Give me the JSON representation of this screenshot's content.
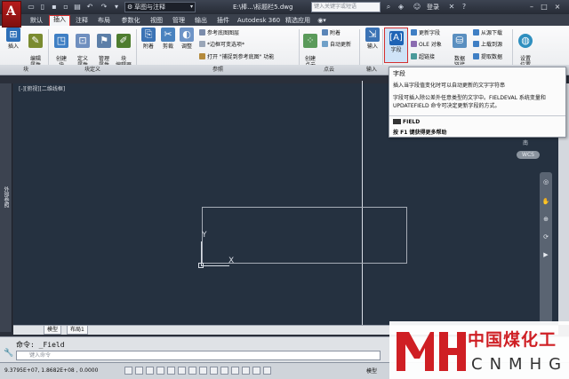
{
  "titlebar": {
    "workspace": "草图与注释",
    "doc_title": "E:\\棒...\\标题栏5.dwg",
    "search_placeholder": "键入关键字或短语",
    "login": "登录"
  },
  "tabs": [
    {
      "label": "默认"
    },
    {
      "label": "插入"
    },
    {
      "label": "注释"
    },
    {
      "label": "布局"
    },
    {
      "label": "参数化"
    },
    {
      "label": "视图"
    },
    {
      "label": "管理"
    },
    {
      "label": "输出"
    },
    {
      "label": "插件"
    },
    {
      "label": "Autodesk 360"
    },
    {
      "label": "精选应用"
    }
  ],
  "ribbon": {
    "insert": "插入",
    "edit_attr": "编辑\n属性",
    "create_block": "创建\n块",
    "define_attr": "定义\n属性",
    "manage_attr": "管理\n属性",
    "block_editor": "块\n编辑器",
    "attach": "附着",
    "clip": "剪裁",
    "adjust": "调整",
    "ref_layers": "参考底图图层",
    "frame_variable": "*边框可变选项*",
    "snap_ref": "打开 \"捕捉到参考底图\" 功能",
    "create_pointcloud": "创建\n点云",
    "attach2": "附着",
    "auto_update": "自动更新",
    "import": "输入",
    "field": "字段",
    "update_fields": "更新字段",
    "ole_object": "OLE 对象",
    "hyperlink": "超链接",
    "data_link": "数据\n链接",
    "download_from": "从源下载",
    "upload_to": "上载到源",
    "extract_data": "提取数据",
    "set_location": "设置\n位置"
  },
  "panels": {
    "block": "块",
    "block_def": "块定义",
    "reference": "参照",
    "pointcloud": "点云",
    "import": "输入"
  },
  "canvas": {
    "viewport_label": "[-][俯视][二维线框]",
    "ucs_y": "Y",
    "ucs_x": "X",
    "wcs": "WCS",
    "north": "南"
  },
  "left_palette": "外部参照",
  "layout_tabs": [
    "模型",
    "布局1"
  ],
  "command": {
    "history": "命令:  _Field",
    "placeholder": "键入命令"
  },
  "statusbar": {
    "coords": "9.3795E+07,  1.8682E+08 , 0.0000",
    "model": "模型"
  },
  "tooltip": {
    "title": "字段",
    "subtitle": "插入当字段值变化时可以自动更新的文字字符串",
    "description": "字段可插入除公差外任意类型的文字中。FIELDEVAL 系统变量和 UPDATEFIELD 命令可决定更新字段的方式。",
    "command": "FIELD",
    "help": "按 F1 键获得更多帮助"
  },
  "watermark": {
    "cn": "中国煤化工",
    "en": "CNMHG"
  }
}
